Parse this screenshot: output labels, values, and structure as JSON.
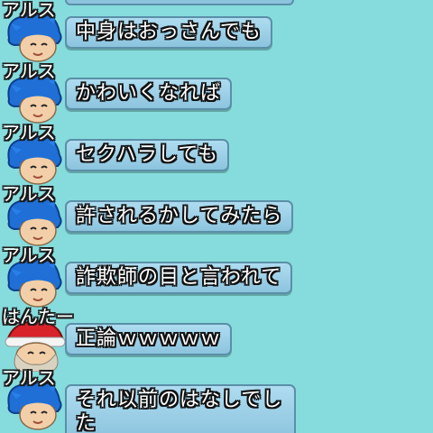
{
  "messages": [
    {
      "user": "アルス",
      "avatar": "blue-hair-hero",
      "text": "中身はおっさんでも"
    },
    {
      "user": "アルス",
      "avatar": "blue-hair-hero",
      "text": "かわいくなれば"
    },
    {
      "user": "アルス",
      "avatar": "blue-hair-hero",
      "text": "セクハラしても"
    },
    {
      "user": "アルス",
      "avatar": "blue-hair-hero",
      "text": "許されるかしてみたら"
    },
    {
      "user": "アルス",
      "avatar": "blue-hair-hero",
      "text": "詐欺師の目と言われて"
    },
    {
      "user": "はんたー",
      "avatar": "santa-hat-elder",
      "text": "正論ｗｗｗｗｗ"
    },
    {
      "user": "アルス",
      "avatar": "blue-hair-hero",
      "text": "それ以前のはなしでした"
    }
  ],
  "colors": {
    "background": "#86dcdc",
    "bubble": "#8cc4de",
    "hair": "#1f6fd6",
    "skin": "#f2cfa8",
    "hat": "#d8232a"
  }
}
